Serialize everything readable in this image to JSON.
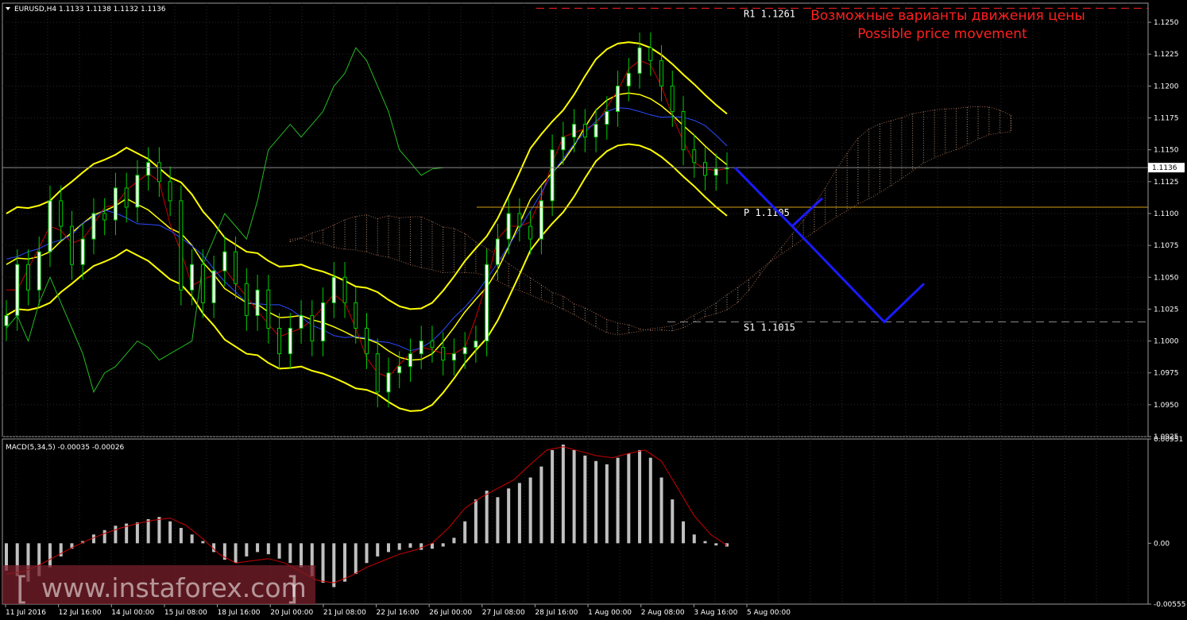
{
  "chart_data": [
    {
      "type": "candlestick",
      "symbol_header": "EURUSD,H4  1.1133 1.1138 1.1132 1.1136",
      "ylim": [
        1.0925,
        1.1265
      ],
      "y_ticks": [
        "1.1250",
        "1.1225",
        "1.1200",
        "1.1175",
        "1.1150",
        "1.1125",
        "1.1100",
        "1.1075",
        "1.1050",
        "1.1025",
        "1.1000",
        "1.0975",
        "1.0950",
        "1.0925"
      ],
      "x_ticks": [
        "11 Jul 2016",
        "12 Jul 16:00",
        "14 Jul 00:00",
        "15 Jul 08:00",
        "18 Jul 16:00",
        "20 Jul 00:00",
        "21 Jul 08:00",
        "22 Jul 16:00",
        "26 Jul 00:00",
        "27 Jul 08:00",
        "28 Jul 16:00",
        "1 Aug 00:00",
        "2 Aug 08:00",
        "3 Aug 16:00",
        "5 Aug 00:00"
      ],
      "current_price": "1.1136",
      "levels": [
        {
          "name": "R1",
          "label": "R1  1.1261",
          "value": 1.1261,
          "style": "dashed",
          "color": "#ff2020"
        },
        {
          "name": "P",
          "label": "P  1.1105",
          "value": 1.1105,
          "style": "solid",
          "color": "#d4a017"
        },
        {
          "name": "S1",
          "label": "S1  1.1015",
          "value": 1.1015,
          "style": "dashed",
          "color": "#888888"
        }
      ],
      "forecast_path": [
        1.1136,
        1.109,
        1.1015,
        1.1045
      ],
      "forecast_branch": [
        1.109,
        1.1112
      ],
      "annotation_ru": "Возможные варианты движения цены",
      "annotation_en": "Possible price movement",
      "ohlc_sample_closes": [
        1.102,
        1.106,
        1.104,
        1.107,
        1.111,
        1.109,
        1.106,
        1.108,
        1.11,
        1.1095,
        1.112,
        1.1105,
        1.113,
        1.114,
        1.1125,
        1.111,
        1.104,
        1.106,
        1.103,
        1.1055,
        1.107,
        1.1045,
        1.102,
        1.104,
        1.101,
        1.099,
        1.101,
        1.102,
        1.1,
        1.103,
        1.105,
        1.103,
        1.101,
        1.099,
        1.096,
        1.0975,
        1.098,
        1.099,
        1.1,
        1.0995,
        1.0985,
        1.099,
        1.0995,
        1.1,
        1.106,
        1.108,
        1.11,
        1.109,
        1.108,
        1.111,
        1.115,
        1.116,
        1.117,
        1.116,
        1.117,
        1.118,
        1.12,
        1.121,
        1.123,
        1.122,
        1.12,
        1.118,
        1.115,
        1.114,
        1.113,
        1.1135,
        1.1136
      ]
    },
    {
      "type": "bar",
      "indicator_header": "MACD(5,34,5) -0.00035 -0.00026",
      "ylim": [
        -0.00555,
        0.00951
      ],
      "y_ticks": [
        "0.00951",
        "0.00",
        "-0.00555"
      ],
      "histogram_values": [
        -0.0025,
        -0.003,
        -0.0035,
        -0.003,
        -0.0022,
        -0.0012,
        -0.0005,
        0.0002,
        0.0008,
        0.0012,
        0.0016,
        0.0018,
        0.0019,
        0.0022,
        0.0024,
        0.002,
        0.0014,
        0.0008,
        0.0002,
        -0.0008,
        -0.0015,
        -0.0018,
        -0.0012,
        -0.0008,
        -0.001,
        -0.0014,
        -0.0018,
        -0.0022,
        -0.003,
        -0.0036,
        -0.004,
        -0.0035,
        -0.0028,
        -0.0018,
        -0.0012,
        -0.0008,
        -0.0006,
        -0.0004,
        -0.0006,
        -0.0005,
        -0.0003,
        0.0005,
        0.002,
        0.004,
        0.0048,
        0.0042,
        0.005,
        0.0055,
        0.006,
        0.007,
        0.0085,
        0.009,
        0.0085,
        0.008,
        0.0075,
        0.0072,
        0.0078,
        0.0082,
        0.0085,
        0.0078,
        0.006,
        0.004,
        0.002,
        0.0008,
        0.0002,
        -0.0002,
        -0.0003
      ],
      "signal_values": [
        -0.0028,
        -0.0026,
        -0.002,
        -0.0012,
        -0.0004,
        0.0003,
        0.0009,
        0.0014,
        0.0018,
        0.0021,
        0.0023,
        0.0016,
        0.0004,
        -0.001,
        -0.0018,
        -0.0016,
        -0.0014,
        -0.0018,
        -0.0026,
        -0.0034,
        -0.0036,
        -0.003,
        -0.0022,
        -0.0016,
        -0.001,
        -0.0006,
        0.0,
        0.0014,
        0.0032,
        0.0042,
        0.005,
        0.0058,
        0.0072,
        0.0085,
        0.0088,
        0.0084,
        0.008,
        0.0078,
        0.0082,
        0.0085,
        0.0075,
        0.005,
        0.0025,
        0.0008,
        -0.0002
      ]
    }
  ],
  "watermark": {
    "open": "[",
    "text": "www.instaforex.com",
    "close": "]"
  }
}
